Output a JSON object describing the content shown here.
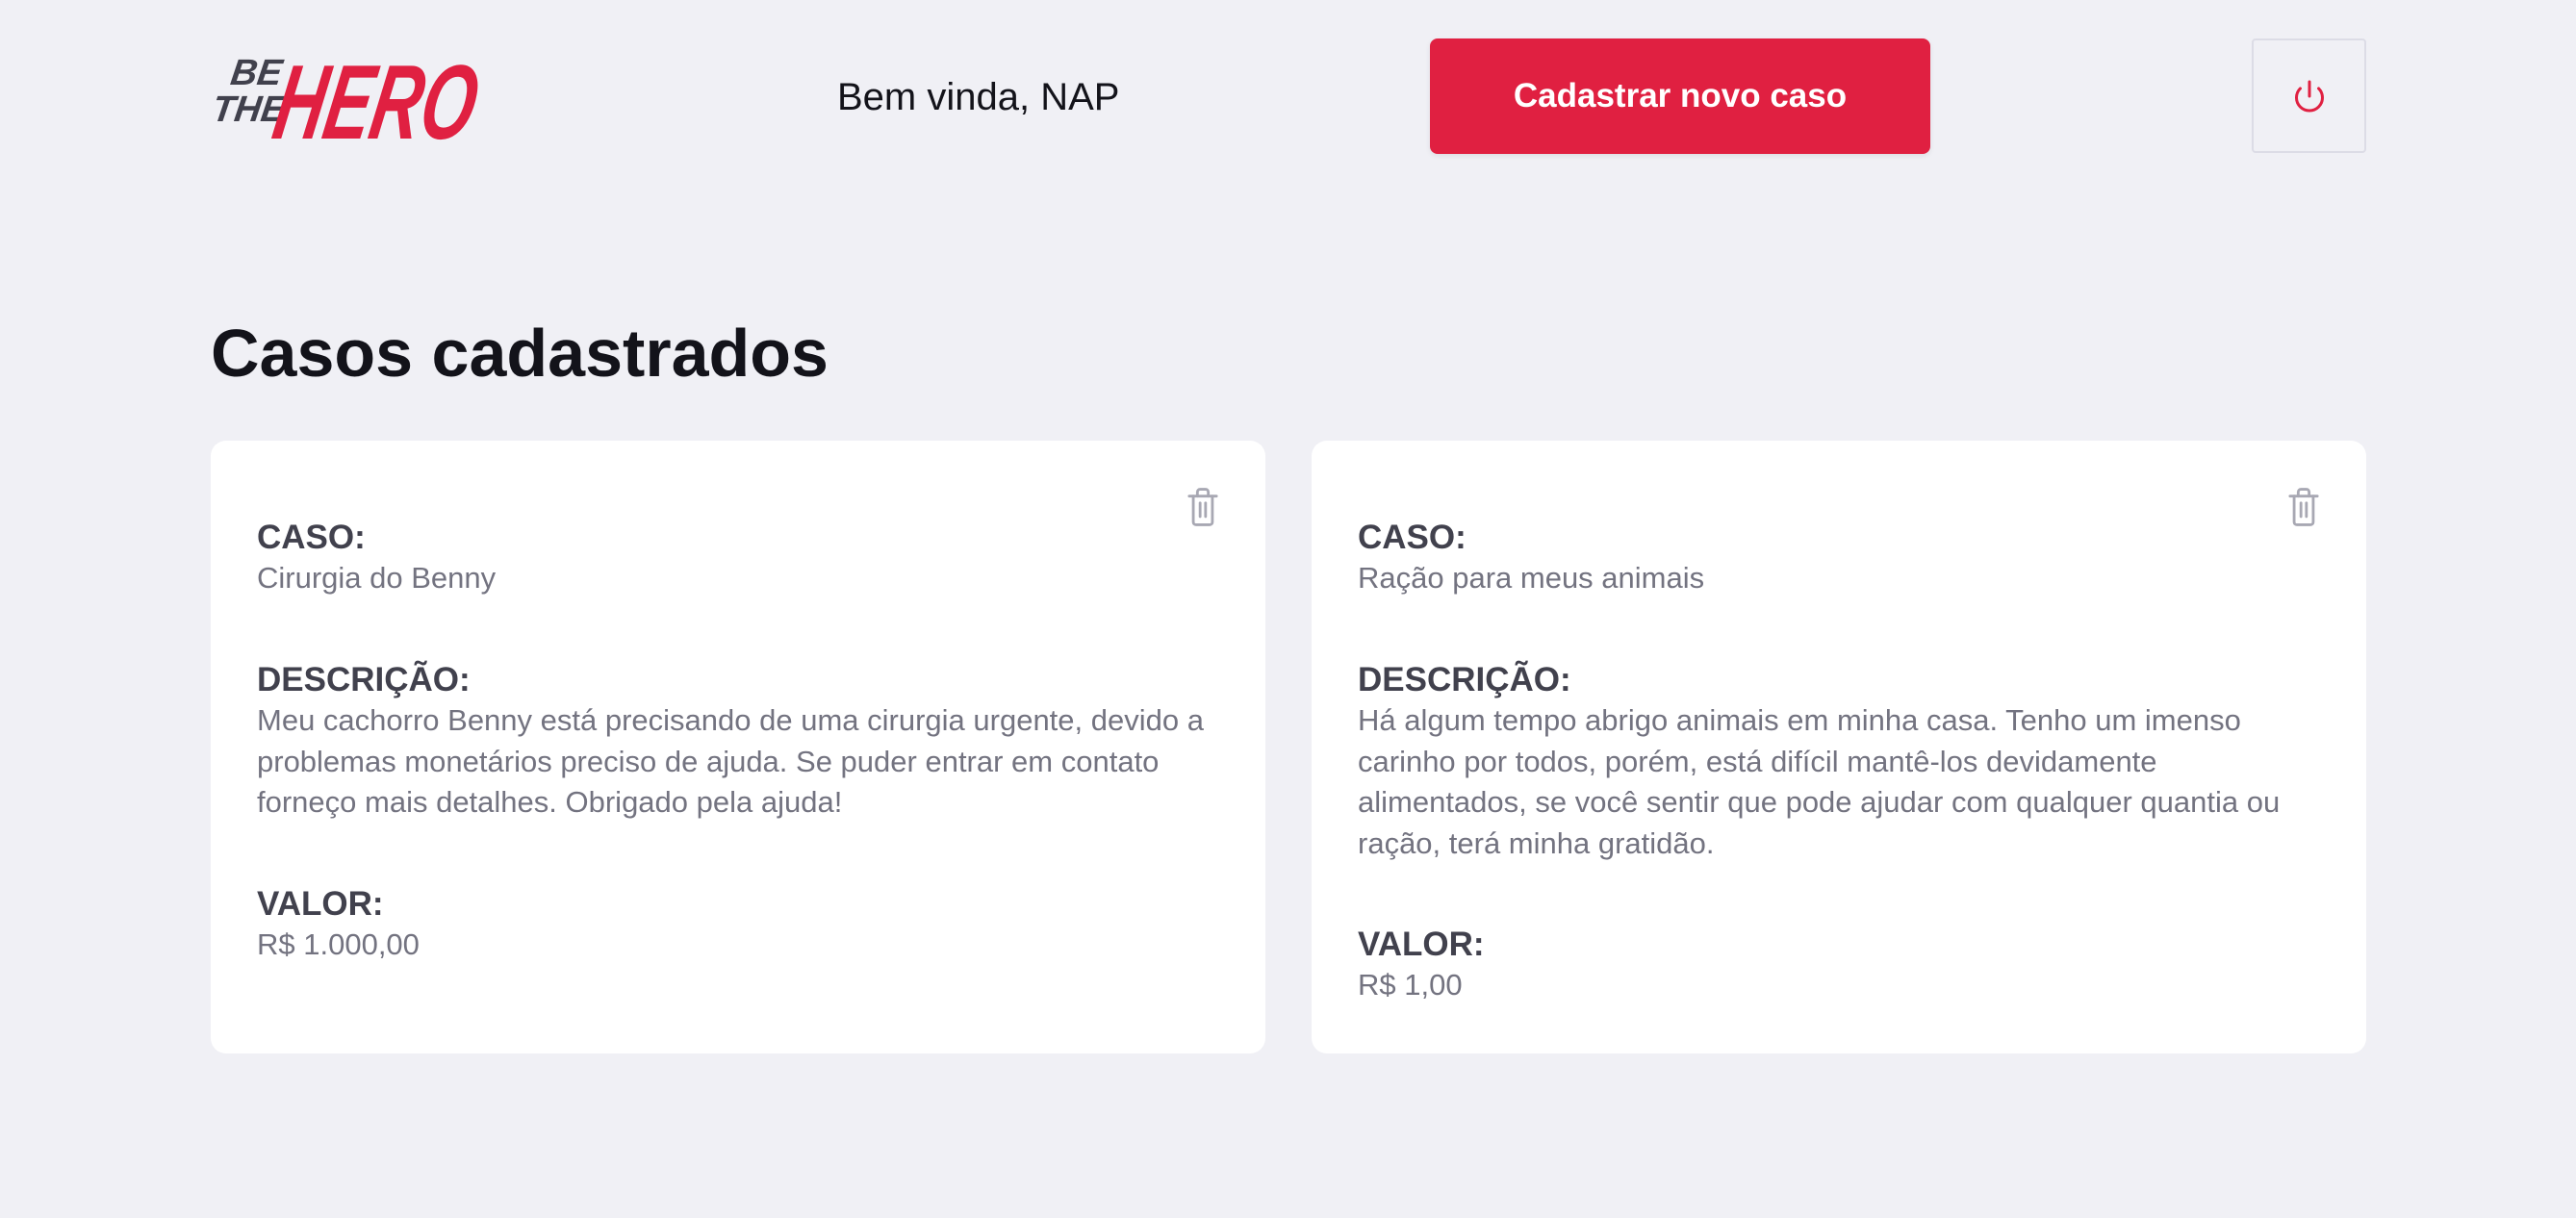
{
  "header": {
    "logo": {
      "line1": "BE",
      "line2": "THE",
      "word": "HERO"
    },
    "welcome": "Bem vinda, NAP",
    "new_case_label": "Cadastrar novo caso",
    "logout_icon": "power-icon"
  },
  "main": {
    "title": "Casos cadastrados",
    "cases": [
      {
        "case_label": "CASO:",
        "case_value": "Cirurgia do Benny",
        "description_label": "DESCRIÇÃO:",
        "description_value": "Meu cachorro Benny está precisando de uma cirurgia urgente, devido a problemas monetários preciso de ajuda. Se puder entrar em contato forneço mais detalhes. Obrigado pela ajuda!",
        "value_label": "VALOR:",
        "value_value": "R$ 1.000,00",
        "delete_icon": "trash-icon"
      },
      {
        "case_label": "CASO:",
        "case_value": "Ração para meus animais",
        "description_label": "DESCRIÇÃO:",
        "description_value": "Há algum tempo abrigo animais em minha casa. Tenho um imenso carinho por todos, porém, está difícil mantê-los devidamente alimentados, se você sentir que pode ajudar com qualquer quantia ou ração, terá minha gratidão.",
        "value_label": "VALOR:",
        "value_value": "R$ 1,00",
        "delete_icon": "trash-icon"
      }
    ]
  },
  "colors": {
    "background": "#f0f0f5",
    "accent": "#e02041",
    "title_text": "#13131a",
    "label_text": "#41414d",
    "value_text": "#737380",
    "icon_gray": "#a8a8b3"
  }
}
